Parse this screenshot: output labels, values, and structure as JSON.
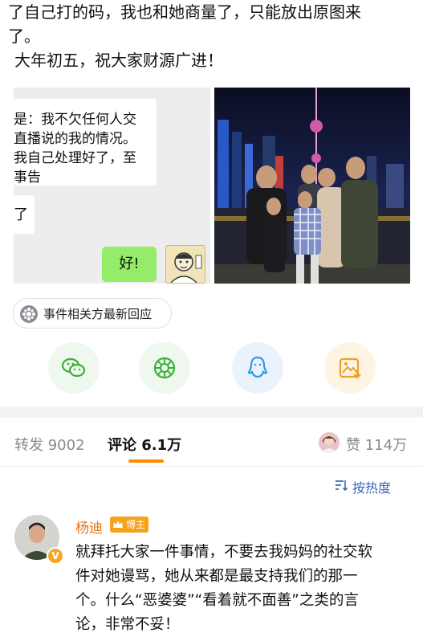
{
  "post": {
    "lines": [
      "了自己打的码，我也和她商量了，只能放出原图来",
      "了。",
      "大年初五，祝大家财源广进！"
    ]
  },
  "chat_image": {
    "bubble1_lines": [
      "是：我不欠任何人交",
      "直播说的我的情况。",
      "我自己处理好了，至",
      "事告"
    ],
    "bubble2": "了",
    "reply": "好!"
  },
  "topic": {
    "label": "事件相关方最新回应"
  },
  "share": {
    "icons": [
      "wechat-icon",
      "moments-icon",
      "qq-icon",
      "save-image-icon"
    ],
    "colors": {
      "wechat": "#3cb035",
      "moments": "#3cb035",
      "qq": "#2e97e8",
      "save": "#f0a023"
    }
  },
  "tabs": {
    "repost": "转发 9002",
    "comments": "评论 6.1万",
    "likes": "赞 114万"
  },
  "sort": {
    "label": "按热度"
  },
  "comment": {
    "author": "杨迪",
    "badge": "博主",
    "lines": [
      "就拜托大家一件事情，不要去我妈妈的社交软",
      "件对她谩骂，她从来都是最支持我们的那一",
      "个。什么“恶婆婆”“看着就不面善”之类的言",
      "论，非常不妥！"
    ]
  },
  "colors": {
    "accent": "#ff8a00",
    "link": "#3a67b8",
    "author": "#e8731e",
    "chat_green": "#95ec69"
  }
}
